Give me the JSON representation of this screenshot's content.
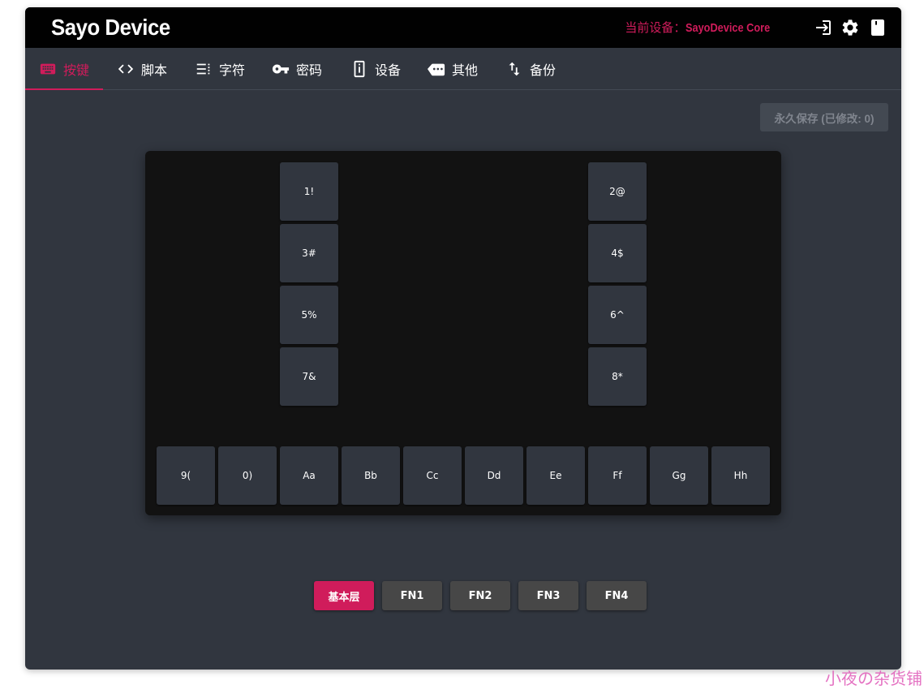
{
  "header": {
    "title": "Sayo Device",
    "device_label": "当前设备：",
    "device_name": "SayoDevice Core",
    "icons": [
      "login-icon",
      "gear-icon",
      "book-icon"
    ]
  },
  "tabs": [
    {
      "label": "按键",
      "icon": "keyboard-icon",
      "active": true
    },
    {
      "label": "脚本",
      "icon": "code-icon",
      "active": false
    },
    {
      "label": "字符",
      "icon": "text-list-icon",
      "active": false
    },
    {
      "label": "密码",
      "icon": "key-icon",
      "active": false
    },
    {
      "label": "设备",
      "icon": "device-icon",
      "active": false
    },
    {
      "label": "其他",
      "icon": "label-more-icon",
      "active": false
    },
    {
      "label": "备份",
      "icon": "swap-vertical-icon",
      "active": false
    }
  ],
  "save_button": "永久保存 (已修改: 0)",
  "keys": {
    "left_column": [
      "1!",
      "3#",
      "5%",
      "7&"
    ],
    "right_column": [
      "2@",
      "4$",
      "6^",
      "8*"
    ],
    "bottom_row": [
      "9(",
      "0)",
      "Aa",
      "Bb",
      "Cc",
      "Dd",
      "Ee",
      "Ff",
      "Gg",
      "Hh"
    ]
  },
  "layers": [
    {
      "label": "基本层",
      "active": true
    },
    {
      "label": "FN1",
      "active": false
    },
    {
      "label": "FN2",
      "active": false
    },
    {
      "label": "FN3",
      "active": false
    },
    {
      "label": "FN4",
      "active": false
    }
  ],
  "watermark": "小夜の杂货铺",
  "colors": {
    "accent": "#d01c5b",
    "background": "#31363f",
    "titlebar": "#010101",
    "keyboard": "#121212",
    "key": "#31363f"
  }
}
